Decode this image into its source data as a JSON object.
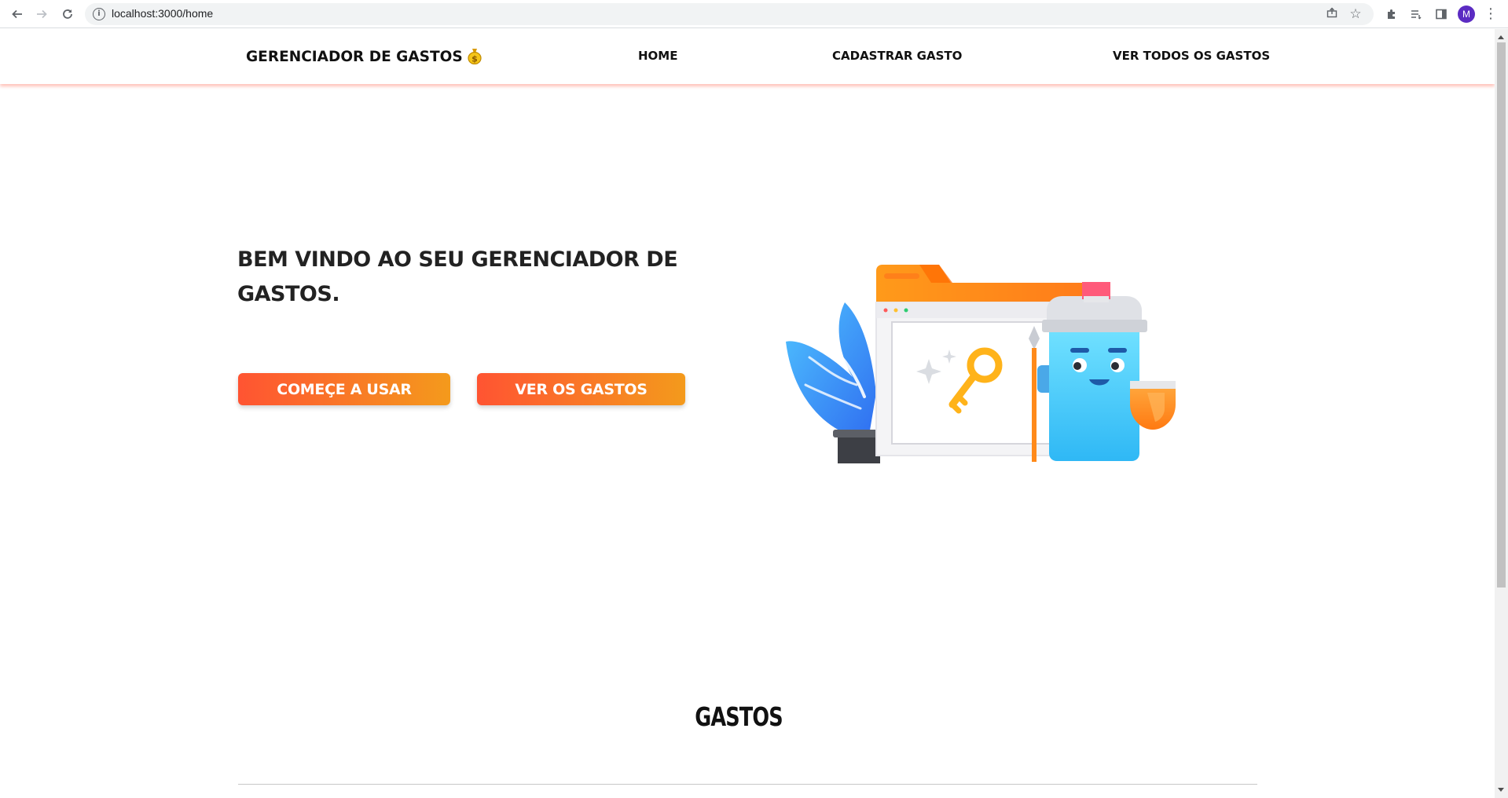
{
  "browser": {
    "url": "localhost:3000/home",
    "profile_initial": "M"
  },
  "navbar": {
    "brand": "GERENCIADOR DE GASTOS",
    "brand_icon": "money-bag-icon",
    "links": [
      {
        "label": "HOME"
      },
      {
        "label": "CADASTRAR GASTO"
      },
      {
        "label": "VER TODOS OS GASTOS"
      }
    ]
  },
  "hero": {
    "title": "BEM VINDO AO SEU GERENCIADOR DE GASTOS.",
    "buttons": {
      "start_label": "COMEÇE A USAR",
      "view_label": "VER OS GASTOS"
    },
    "illustration": "folder-key-robot-illustration"
  },
  "section": {
    "title": "GASTOS"
  },
  "colors": {
    "button_gradient_start": "#ff5432",
    "button_gradient_end": "#f49a1c",
    "navbar_shadow": "#ff7864",
    "text_dark": "#222222"
  }
}
